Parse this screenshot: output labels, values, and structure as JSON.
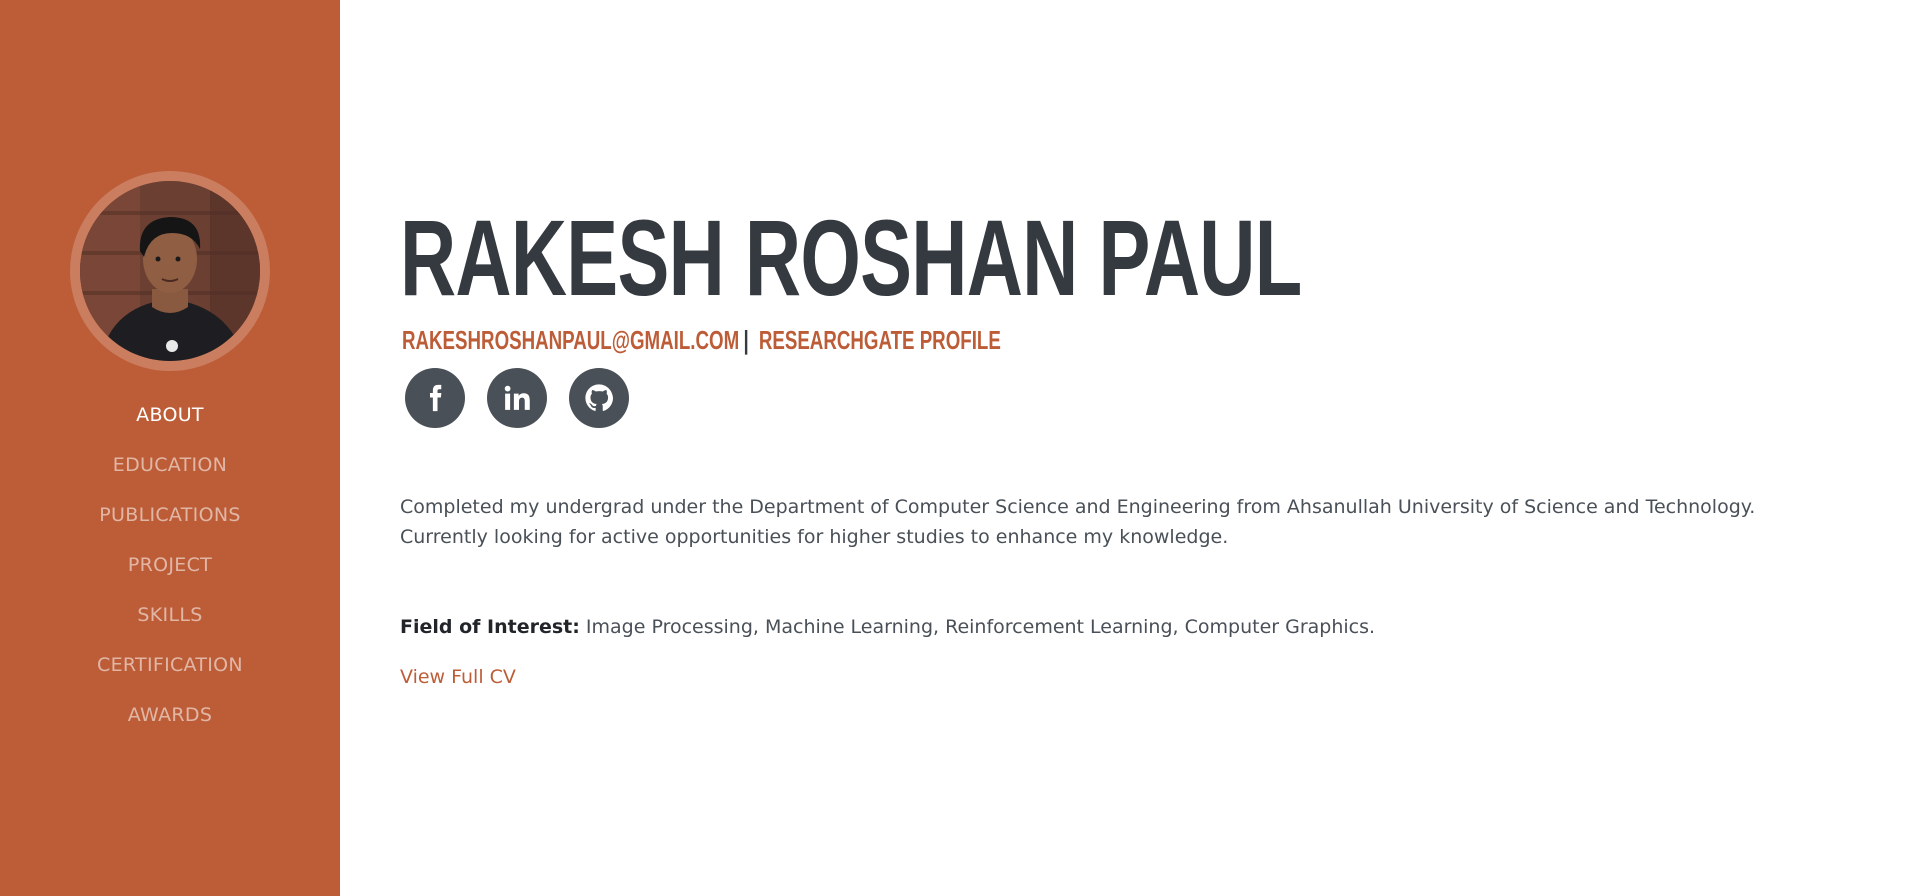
{
  "sidebar": {
    "avatar_alt": "profile photo",
    "nav": [
      {
        "label": "ABOUT",
        "active": true
      },
      {
        "label": "EDUCATION",
        "active": false
      },
      {
        "label": "PUBLICATIONS",
        "active": false
      },
      {
        "label": "PROJECT",
        "active": false
      },
      {
        "label": "SKILLS",
        "active": false
      },
      {
        "label": "CERTIFICATION",
        "active": false
      },
      {
        "label": "AWARDS",
        "active": false
      }
    ]
  },
  "header": {
    "name": "RAKESH ROSHAN PAUL",
    "email": "RAKESHROSHANPAUL@GMAIL.COM",
    "separator": "|",
    "researchgate": "RESEARCHGATE PROFILE"
  },
  "social": [
    {
      "icon": "facebook-icon"
    },
    {
      "icon": "linkedin-icon"
    },
    {
      "icon": "github-icon"
    }
  ],
  "about": {
    "summary": "Completed my undergrad under the Department of Computer Science and Engineering from Ahsanullah University of Science and Technology. Currently looking for active opportunities for higher studies to enhance my knowledge.",
    "interest_label": "Field of Interest:",
    "interest_text": " Image Processing, Machine Learning, Reinforcement Learning, Computer Graphics.",
    "cv_link": "View Full CV"
  },
  "colors": {
    "sidebar_bg": "#bd5d38",
    "accent": "#bd5d38",
    "heading": "#343a40",
    "social_bg": "#495057"
  }
}
